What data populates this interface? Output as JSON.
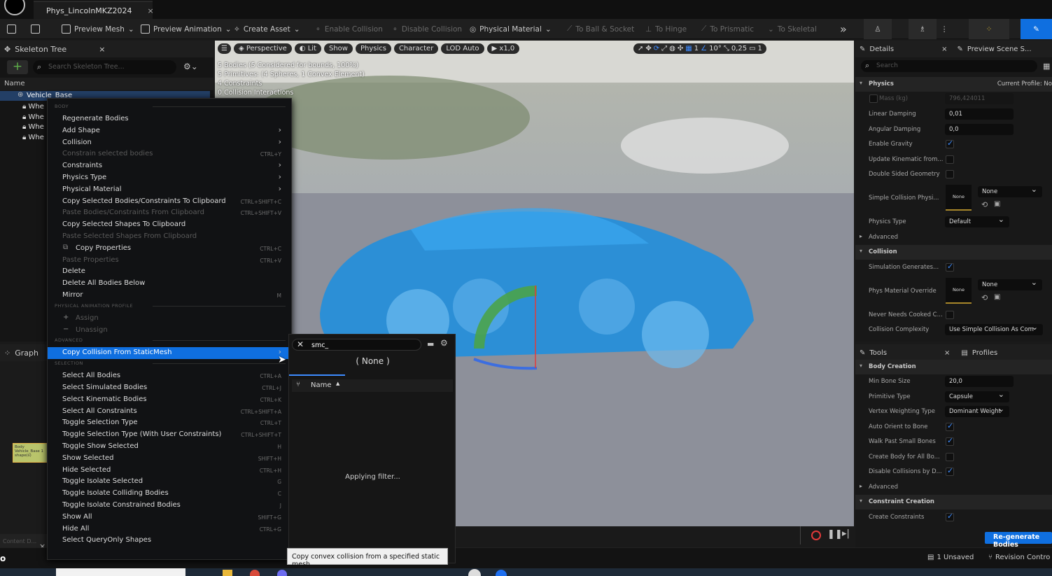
{
  "window": {
    "tab_title": "Phys_LincolnMKZ2024"
  },
  "toolbar": {
    "preview_mesh": "Preview Mesh",
    "preview_animation": "Preview Animation",
    "create_asset": "Create Asset",
    "enable_collision": "Enable Collision",
    "disable_collision": "Disable Collision",
    "physical_material": "Physical Material",
    "to_ball_socket": "To Ball & Socket",
    "to_hinge": "To Hinge",
    "to_prismatic": "To Prismatic",
    "to_skeletal": "To Skeletal"
  },
  "skeleton_tree": {
    "title": "Skeleton Tree",
    "search_placeholder": "Search Skeleton Tree...",
    "column_name": "Name",
    "items": [
      "Vehicle_Base",
      "Whe",
      "Whe",
      "Whe",
      "Whe"
    ]
  },
  "graph": {
    "title": "Graph",
    "node_label": "Body Vehicle_Base 1 shape(s)"
  },
  "viewport": {
    "perspective": "Perspective",
    "lit": "Lit",
    "show": "Show",
    "physics": "Physics",
    "character": "Character",
    "lod": "LOD Auto",
    "speed": "x1,0",
    "grid_value": "1",
    "angle_value": "10°",
    "scale_value": "0,25",
    "camera_speed": "1",
    "stats": [
      "5 Bodies (5 Considered for bounds, 100%)",
      "5 Primitives: (4 Spheres, 1 Convex Element)",
      "4 Constraints",
      "0 Collision Interactions"
    ]
  },
  "context_menu": {
    "sections": {
      "body": "BODY",
      "profile": "PHYSICAL ANIMATION PROFILE",
      "advanced": "ADVANCED",
      "selection": "SELECTION"
    },
    "items": [
      {
        "label": "Regenerate Bodies",
        "shortcut": "",
        "arrow": false,
        "disabled": false
      },
      {
        "label": "Add Shape",
        "shortcut": "",
        "arrow": true,
        "disabled": false
      },
      {
        "label": "Collision",
        "shortcut": "",
        "arrow": true,
        "disabled": false
      },
      {
        "label": "Constrain selected bodies",
        "shortcut": "CTRL+Y",
        "arrow": false,
        "disabled": true
      },
      {
        "label": "Constraints",
        "shortcut": "",
        "arrow": true,
        "disabled": false
      },
      {
        "label": "Physics Type",
        "shortcut": "",
        "arrow": true,
        "disabled": false
      },
      {
        "label": "Physical Material",
        "shortcut": "",
        "arrow": true,
        "disabled": false
      },
      {
        "label": "Copy Selected Bodies/Constraints To Clipboard",
        "shortcut": "CTRL+SHIFT+C",
        "arrow": false,
        "disabled": false
      },
      {
        "label": "Paste Bodies/Constraints From Clipboard",
        "shortcut": "CTRL+SHIFT+V",
        "arrow": false,
        "disabled": true
      },
      {
        "label": "Copy Selected Shapes To Clipboard",
        "shortcut": "",
        "arrow": false,
        "disabled": false
      },
      {
        "label": "Paste Selected Shapes From Clipboard",
        "shortcut": "",
        "arrow": false,
        "disabled": true
      },
      {
        "label": "Copy Properties",
        "shortcut": "CTRL+C",
        "arrow": false,
        "disabled": false
      },
      {
        "label": "Paste Properties",
        "shortcut": "CTRL+V",
        "arrow": false,
        "disabled": true
      },
      {
        "label": "Delete",
        "shortcut": "",
        "arrow": false,
        "disabled": false
      },
      {
        "label": "Delete All Bodies Below",
        "shortcut": "",
        "arrow": false,
        "disabled": false
      },
      {
        "label": "Mirror",
        "shortcut": "M",
        "arrow": false,
        "disabled": false
      }
    ],
    "profile_items": [
      {
        "label": "Assign",
        "disabled": true
      },
      {
        "label": "Unassign",
        "disabled": true
      }
    ],
    "advanced_item": "Copy Collision From StaticMesh",
    "selection_items": [
      {
        "label": "Select All Bodies",
        "shortcut": "CTRL+A"
      },
      {
        "label": "Select Simulated Bodies",
        "shortcut": "CTRL+J"
      },
      {
        "label": "Select Kinematic Bodies",
        "shortcut": "CTRL+K"
      },
      {
        "label": "Select All Constraints",
        "shortcut": "CTRL+SHIFT+A"
      },
      {
        "label": "Toggle Selection Type",
        "shortcut": "CTRL+T"
      },
      {
        "label": "Toggle Selection Type (With User Constraints)",
        "shortcut": "CTRL+SHIFT+T"
      },
      {
        "label": "Toggle Show Selected",
        "shortcut": "H"
      },
      {
        "label": "Show Selected",
        "shortcut": "SHIFT+H"
      },
      {
        "label": "Hide Selected",
        "shortcut": "CTRL+H"
      },
      {
        "label": "Toggle Isolate Selected",
        "shortcut": "G"
      },
      {
        "label": "Toggle Isolate Colliding Bodies",
        "shortcut": "C"
      },
      {
        "label": "Toggle Isolate Constrained Bodies",
        "shortcut": "J"
      },
      {
        "label": "Show All",
        "shortcut": "SHIFT+G"
      },
      {
        "label": "Hide All",
        "shortcut": "CTRL+G"
      },
      {
        "label": "Select QueryOnly Shapes",
        "shortcut": ""
      }
    ]
  },
  "asset_picker": {
    "search_value": "smc_",
    "none_label": "( None )",
    "column_name": "Name",
    "status": "Applying filter..."
  },
  "tooltip": "Copy convex collision from a specified static mesh",
  "details": {
    "tab_details": "Details",
    "tab_preview": "Preview Scene S...",
    "search_placeholder": "Search",
    "physics_section": "Physics",
    "current_profile": "Current Profile: No",
    "mass_label": "Mass (kg)",
    "mass_value": "796,424011",
    "linear_damping_label": "Linear Damping",
    "linear_damping": "0,01",
    "angular_damping_label": "Angular Damping",
    "angular_damping": "0,0",
    "enable_gravity": "Enable Gravity",
    "update_kinematic": "Update Kinematic from...",
    "double_sided": "Double Sided Geometry",
    "simple_collision": "Simple Collision Physi...",
    "none": "None",
    "physics_type_label": "Physics Type",
    "physics_type": "Default",
    "advanced": "Advanced",
    "collision_section": "Collision",
    "sim_generates": "Simulation Generates...",
    "phys_mat_override": "Phys Material Override",
    "never_needs_cooked": "Never Needs Cooked C...",
    "collision_complexity_label": "Collision Complexity",
    "collision_complexity": "Use Simple Collision As Com"
  },
  "tools": {
    "tab_tools": "Tools",
    "tab_profiles": "Profiles",
    "body_creation": "Body Creation",
    "min_bone_size_label": "Min Bone Size",
    "min_bone_size": "20,0",
    "primitive_type_label": "Primitive Type",
    "primitive_type": "Capsule",
    "vertex_weighting_label": "Vertex Weighting Type",
    "vertex_weighting": "Dominant Weight",
    "auto_orient": "Auto Orient to Bone",
    "walk_past": "Walk Past Small Bones",
    "create_body_all": "Create Body for All Bo...",
    "disable_collisions": "Disable Collisions by D...",
    "advanced": "Advanced",
    "constraint_creation": "Constraint Creation",
    "create_constraints": "Create Constraints",
    "regenerate": "Re-generate Bodies"
  },
  "statusbar": {
    "unsaved": "1 Unsaved",
    "revision": "Revision Contro",
    "content_drawer": "Content D..."
  }
}
